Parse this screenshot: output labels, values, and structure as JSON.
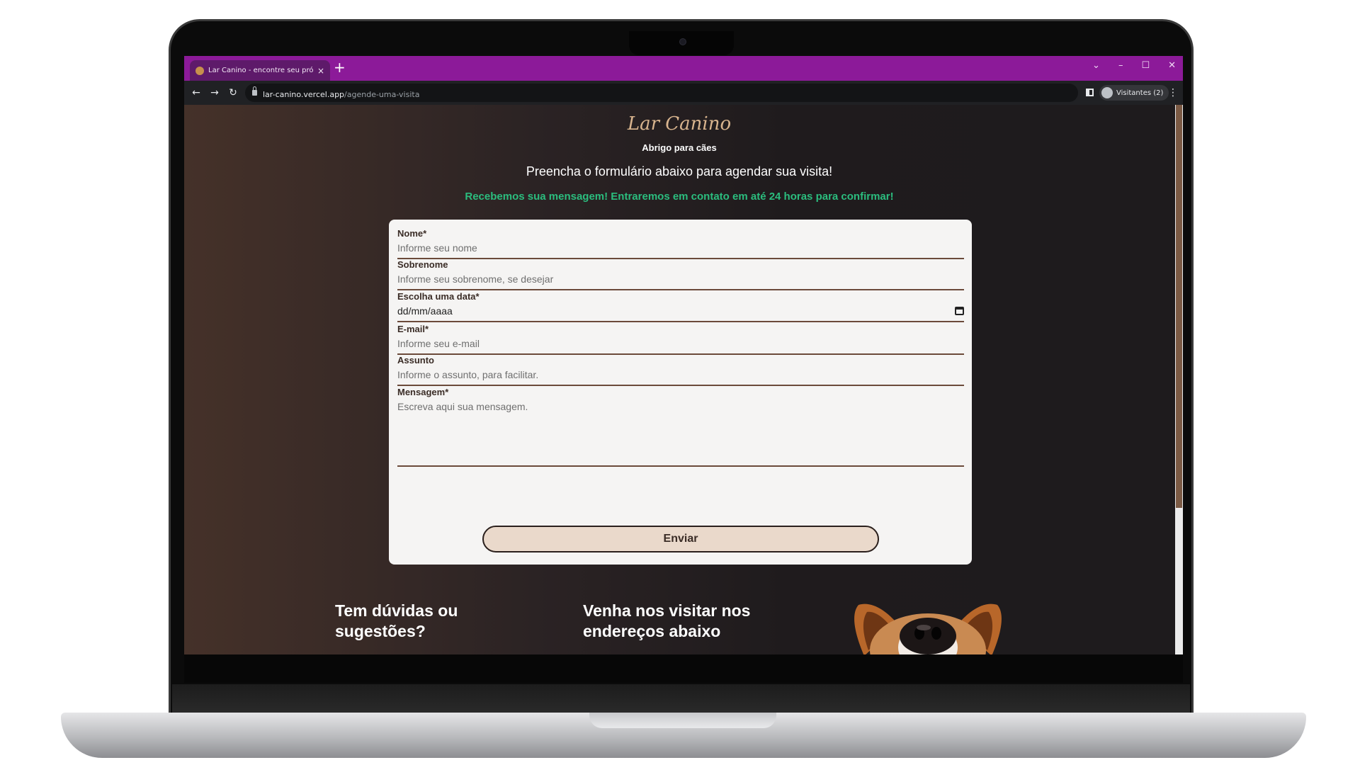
{
  "browser": {
    "tab_title": "Lar Canino - encontre seu próximo amigo",
    "tab_close": "×",
    "new_tab": "+",
    "url_host": "lar-canino.vercel.app",
    "url_path": "/agende-uma-visita",
    "profile_label": "Visitantes (2)",
    "window_controls": {
      "tab_search": "⌄",
      "minimize": "–",
      "maximize": "☐",
      "close": "✕"
    },
    "nav": {
      "back": "←",
      "forward": "→",
      "reload": "↻"
    },
    "menu": "⋮"
  },
  "header": {
    "logo": "Lar Canino",
    "tagline": "Abrigo para cães"
  },
  "main": {
    "heading": "Preencha o formulário abaixo para agendar sua visita!",
    "success_message": "Recebemos sua mensagem! Entraremos em contato em até 24 horas para confirmar!"
  },
  "form": {
    "nome": {
      "label": "Nome*",
      "placeholder": "Informe seu nome"
    },
    "sobrenome": {
      "label": "Sobrenome",
      "placeholder": "Informe seu sobrenome, se desejar"
    },
    "data": {
      "label": "Escolha uma data*",
      "value": "dd/mm/aaaa"
    },
    "email": {
      "label": "E-mail*",
      "placeholder": "Informe seu e-mail"
    },
    "assunto": {
      "label": "Assunto",
      "placeholder": "Informe o assunto, para facilitar."
    },
    "mensagem": {
      "label": "Mensagem*",
      "placeholder": "Escreva aqui sua mensagem."
    },
    "submit_label": "Enviar"
  },
  "footer": {
    "questions_title": "Tem dúvidas ou sugestões?",
    "visit_title": "Venha nos visitar nos endereços abaixo"
  },
  "colors": {
    "tabbar": "#8c1a99",
    "accent_success": "#2bbd7e",
    "logo": "#d8b48e",
    "button_bg": "#ead9cb"
  }
}
